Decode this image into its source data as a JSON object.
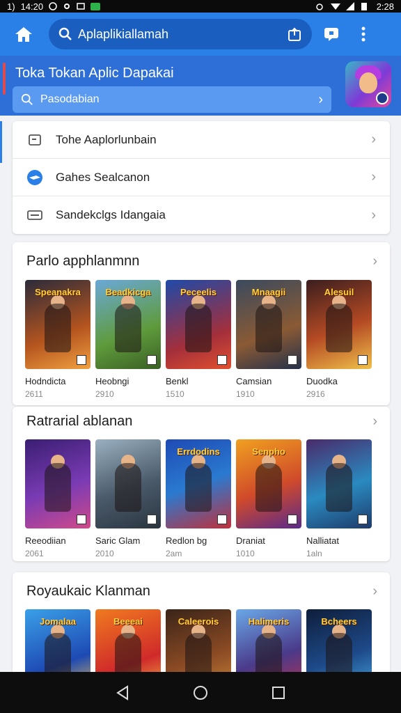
{
  "status_bar": {
    "time": "14:20",
    "left_code": "1)",
    "right_time": "2:28"
  },
  "appbar": {
    "search_text": "Aplaplikiallamah"
  },
  "hero": {
    "title": "Toka Tokan Aplic Dapakai",
    "search_placeholder": "Pasodabian"
  },
  "menu": [
    {
      "label": "Tohe Aaplorlunbain",
      "icon": "document-icon"
    },
    {
      "label": "Gahes Sealcanon",
      "icon": "globe-icon"
    },
    {
      "label": "Sandekclgs Idangaia",
      "icon": "keyboard-icon"
    }
  ],
  "sections": [
    {
      "title": "Parlo apphlanmnn",
      "items": [
        {
          "name": "Hodndicta",
          "sub": "2611",
          "logo": "Speanakra",
          "bg": "linear-gradient(160deg,#2b2b3a,#b4541f 60%,#f0a040)"
        },
        {
          "name": "Heobngi",
          "sub": "2910",
          "logo": "Beadkicga",
          "bg": "linear-gradient(160deg,#6aa8d8,#5f9b3c 60%,#3a5f24)"
        },
        {
          "name": "Benkl",
          "sub": "1510",
          "logo": "Peceelis",
          "bg": "linear-gradient(160deg,#1f4aa8,#a42f3b 65%,#e0502f)"
        },
        {
          "name": "Camsian",
          "sub": "1910",
          "logo": "Mnaagii",
          "bg": "linear-gradient(160deg,#3a4a5e,#8a5a34 60%,#24304a)"
        },
        {
          "name": "Duodka",
          "sub": "2916",
          "logo": "Alesuil",
          "bg": "linear-gradient(160deg,#3b1e1e,#b44a24 55%,#f0c04a)"
        }
      ]
    },
    {
      "title": "Ratrarial ablanan",
      "items": [
        {
          "name": "Reeodiian",
          "sub": "2061",
          "logo": "",
          "bg": "linear-gradient(160deg,#3a1e72,#7a3bb4 55%,#d04a8a)"
        },
        {
          "name": "Saric Glam",
          "sub": "2010",
          "logo": "",
          "bg": "linear-gradient(160deg,#9ab0c0,#4a5a6a 55%,#2a3440)"
        },
        {
          "name": "Redlon bg",
          "sub": "2am",
          "logo": "Errdodins",
          "bg": "linear-gradient(160deg,#1e4ab4,#2a7ad0 50%,#c0303a)"
        },
        {
          "name": "Draniat",
          "sub": "1010",
          "logo": "Senpho",
          "bg": "linear-gradient(160deg,#f0a020,#d04a2a 55%,#5a2a8a)"
        },
        {
          "name": "Nalliatat",
          "sub": "1aln",
          "logo": "",
          "bg": "linear-gradient(160deg,#4a2a6a,#2a8ac0 55%,#1e3a6a)"
        }
      ]
    },
    {
      "title": "Royaukaic Klanman",
      "items": [
        {
          "name": "",
          "sub": "",
          "logo": "Jomalaa",
          "bg": "linear-gradient(160deg,#3aa0e8,#1e4ab4 60%,#f0c04a)"
        },
        {
          "name": "",
          "sub": "",
          "logo": "Beeeai",
          "bg": "linear-gradient(160deg,#f07a20,#d02a2a 60%,#f0c04a)"
        },
        {
          "name": "",
          "sub": "",
          "logo": "Caleerois",
          "bg": "linear-gradient(160deg,#3a2418,#8a4a24 55%,#d08a3a)"
        },
        {
          "name": "",
          "sub": "",
          "logo": "Halimeris",
          "bg": "linear-gradient(160deg,#6aa8e8,#4a3a8a 55%,#c0304a)"
        },
        {
          "name": "",
          "sub": "",
          "logo": "Bcheers",
          "bg": "linear-gradient(160deg,#0e1e3a,#1e4a8a 55%,#4ab0e8)"
        }
      ]
    }
  ]
}
